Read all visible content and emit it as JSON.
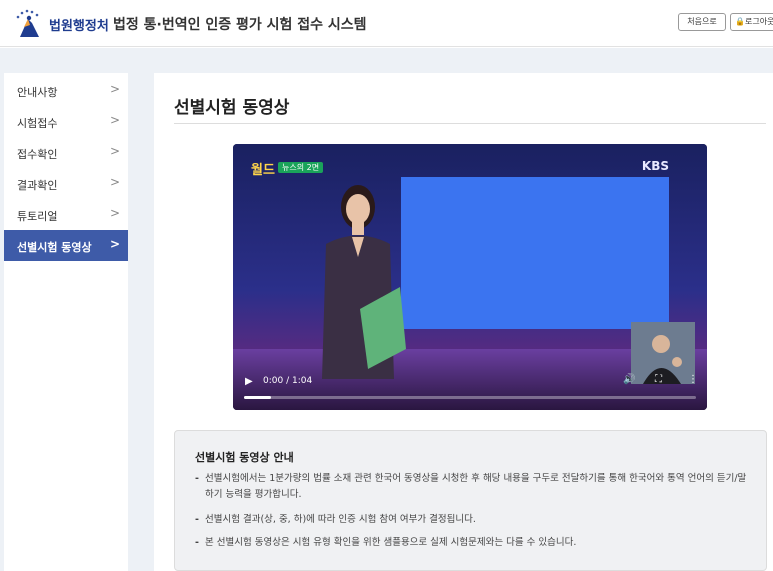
{
  "header": {
    "org_name": "법원행정처",
    "system_title": "법정 통·번역인 인증 평가 시험 접수 시스템",
    "home_button": "처음으로",
    "logout_button": "로그아웃"
  },
  "sidebar": {
    "items": [
      {
        "label": "안내사항",
        "active": false
      },
      {
        "label": "시험접수",
        "active": false
      },
      {
        "label": "접수확인",
        "active": false
      },
      {
        "label": "결과확인",
        "active": false
      },
      {
        "label": "튜토리얼",
        "active": false
      },
      {
        "label": "선별시험 동영상",
        "active": true
      }
    ],
    "active_color": "#3e5ba8"
  },
  "main": {
    "page_title": "선별시험 동영상",
    "video": {
      "program_logo": "월드",
      "news_badge": "뉴스의 2면",
      "channel_logo": "KBS",
      "time_display": "0:00 / 1:04",
      "progress": 0.06,
      "screen_color": "#3b74f0"
    },
    "info": {
      "title": "선별시험 동영상 안내",
      "bullets": [
        "선별시험에서는 1분가량의 법률 소재 관련 한국어 동영상을 시청한 후 해당 내용을 구두로 전달하기를 통해 한국어와 통역 언어의 듣기/말하기 능력을 평가합니다.",
        "선별시험 결과(상, 중, 하)에 따라 인증 시험 참여 여부가 결정됩니다.",
        "본 선별시험 동영상은 시험 유형 확인을 위한 샘플용으로 실제 시험문제와는 다를 수 있습니다."
      ]
    }
  }
}
